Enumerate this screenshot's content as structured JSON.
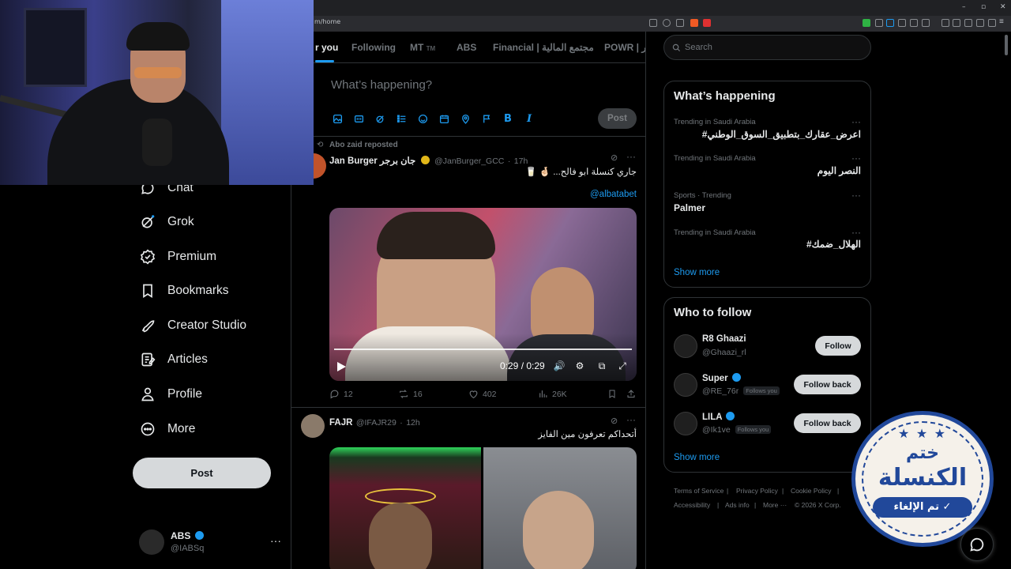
{
  "browser": {
    "url_fragment": "m/home",
    "window_controls": [
      "–",
      "▫",
      "✕"
    ]
  },
  "nav": {
    "items": [
      {
        "label": "Chat",
        "icon": "chat-icon"
      },
      {
        "label": "Grok",
        "icon": "grok-icon"
      },
      {
        "label": "Premium",
        "icon": "premium-icon"
      },
      {
        "label": "Bookmarks",
        "icon": "bookmark-icon"
      },
      {
        "label": "Creator Studio",
        "icon": "rocket-icon"
      },
      {
        "label": "Articles",
        "icon": "articles-icon"
      },
      {
        "label": "Profile",
        "icon": "profile-icon"
      },
      {
        "label": "More",
        "icon": "more-circle-icon"
      }
    ],
    "post_label": "Post",
    "account": {
      "name": "ABS",
      "handle": "@IABSq",
      "menu": "···"
    }
  },
  "timeline": {
    "tabs": [
      "r you",
      "Following",
      "MT",
      "ABS",
      "Financial | مجتمع المالية",
      "POWR | ور"
    ],
    "tab_suffix_mt": "TM",
    "compose": {
      "placeholder": "What’s happening?",
      "post_label": "Post",
      "tools": [
        "image-icon",
        "gif-icon",
        "grok-icon",
        "poll-icon",
        "emoji-icon",
        "schedule-icon",
        "location-icon",
        "flag-icon",
        "bold-icon",
        "italic-icon"
      ],
      "bold_glyph": "B",
      "italic_glyph": "I"
    },
    "tweets": [
      {
        "repost_note": "Abo zaid reposted",
        "name": "Jan Burger جان برجر",
        "handle": "@JanBurger_GCC",
        "time": "17h",
        "text": "جاري كنسلة ابو فالح... 🤞🏻 🥛",
        "mention": "@albatabet",
        "video_time": "0:29 / 0:29",
        "replies": "12",
        "reposts": "16",
        "likes": "402",
        "views": "26K"
      },
      {
        "name": "FAJR",
        "handle": "@IFAJR29",
        "time": "12h",
        "text": "أتحداكم تعرفون مين الفايز"
      }
    ]
  },
  "sidebar": {
    "search_placeholder": "Search",
    "happening": {
      "title": "What’s happening",
      "trends": [
        {
          "meta": "Trending in Saudi Arabia",
          "title": "#اعرض_عقارك_بتطبيق_السوق_الوطني"
        },
        {
          "meta": "Trending in Saudi Arabia",
          "title": "النصر اليوم"
        },
        {
          "meta": "Sports · Trending",
          "title": "Palmer"
        },
        {
          "meta": "Trending in Saudi Arabia",
          "title": "#الهلال_ضمك"
        }
      ],
      "show_more": "Show more"
    },
    "who_to_follow": {
      "title": "Who to follow",
      "users": [
        {
          "name": "R8 Ghaazi",
          "handle": "@Ghaazi_rl",
          "follows_you": "",
          "button": "Follow"
        },
        {
          "name": "Super",
          "handle": "@RE_76r",
          "follows_you": "Follows you",
          "button": "Follow back"
        },
        {
          "name": "LILA",
          "handle": "@Ik1ve",
          "follows_you": "Follows you",
          "button": "Follow back"
        }
      ],
      "show_more": "Show more"
    },
    "footer": [
      "Terms of Service",
      "|",
      "Privacy Policy",
      "|",
      "Cookie Policy",
      "|",
      "Accessibility",
      "|",
      "Ads info",
      "|",
      "More ···",
      "© 2026 X Corp."
    ]
  },
  "stamp": {
    "stars": "★ ★ ★",
    "line1": "ختم",
    "line2": "الكنسلة",
    "line3": "تم الإلغاء ✓"
  },
  "colors": {
    "accent": "#1d9bf0",
    "verified": "#1d9bf0",
    "gold": "#e2b719",
    "stamp": "#21489a"
  }
}
